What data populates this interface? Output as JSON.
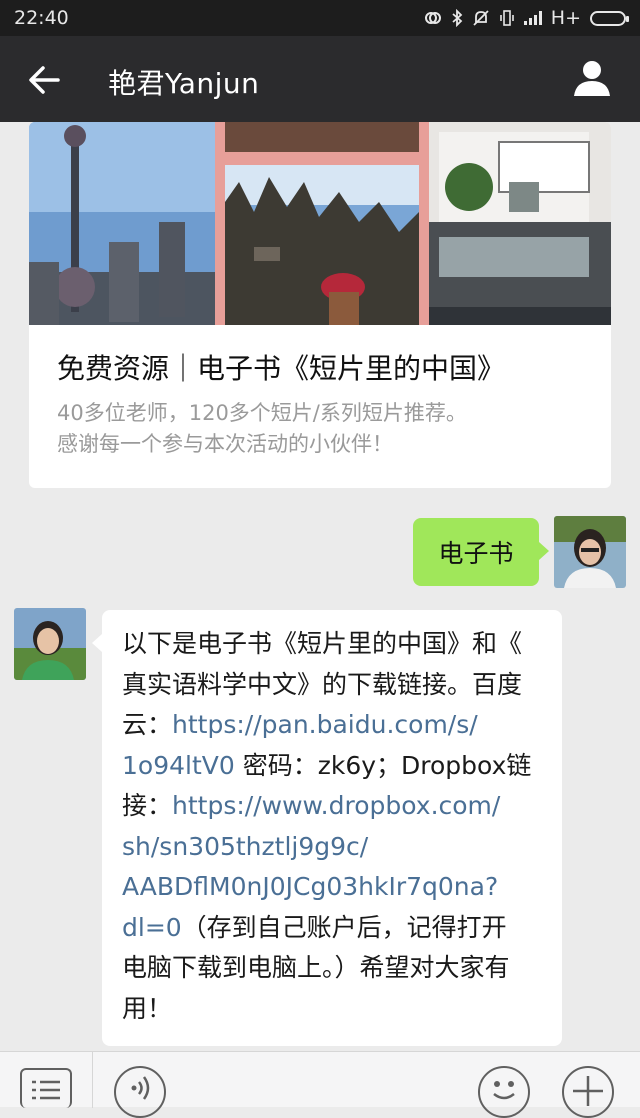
{
  "status_bar": {
    "time": "22:40",
    "network": "H+",
    "icons": [
      "sync-icon",
      "bluetooth-icon",
      "mute-icon",
      "vibrate-icon",
      "signal-icon",
      "battery-icon"
    ]
  },
  "header": {
    "title": "艳君Yanjun",
    "back_icon": "back-arrow-icon",
    "profile_icon": "person-icon",
    "background": "#2b2b2d"
  },
  "article_card": {
    "title": "免费资源｜电子书《短片里的中国》",
    "description_lines": [
      "40多位老师，120多个短片/系列短片推荐。",
      "感谢每一个参与本次活动的小伙伴！"
    ]
  },
  "messages": {
    "outgoing": {
      "text": "电子书",
      "bubble_color": "#a0e75a"
    },
    "incoming": {
      "lines": [
        [
          {
            "t": "以下是电子书《短片里的中国》和《",
            "link": false
          }
        ],
        [
          {
            "t": "真实语料学中文》的下载链接。百度",
            "link": false
          }
        ],
        [
          {
            "t": "云：",
            "link": false
          },
          {
            "t": "https://pan.baidu.com/s/",
            "link": true
          }
        ],
        [
          {
            "t": "1o94ltV0",
            "link": true
          },
          {
            "t": " 密码：zk6y；Dropbox链",
            "link": false
          }
        ],
        [
          {
            "t": "接：",
            "link": false
          },
          {
            "t": "https://www.dropbox.com/",
            "link": true
          }
        ],
        [
          {
            "t": "sh/sn305thztlj9g9c/",
            "link": true
          }
        ],
        [
          {
            "t": "AABDflM0nJ0JCg03hkIr7q0na?",
            "link": true
          }
        ],
        [
          {
            "t": "dl=0",
            "link": true
          },
          {
            "t": "（存到自己账户后，记得打开",
            "link": false
          }
        ],
        [
          {
            "t": "电脑下载到电脑上。）希望对大家有",
            "link": false
          }
        ],
        [
          {
            "t": "用！",
            "link": false
          }
        ]
      ],
      "link_color": "#4a6f95"
    }
  },
  "toolbar": {
    "icons": [
      "menu-icon",
      "voice-icon",
      "emoji-icon",
      "plus-icon"
    ]
  }
}
